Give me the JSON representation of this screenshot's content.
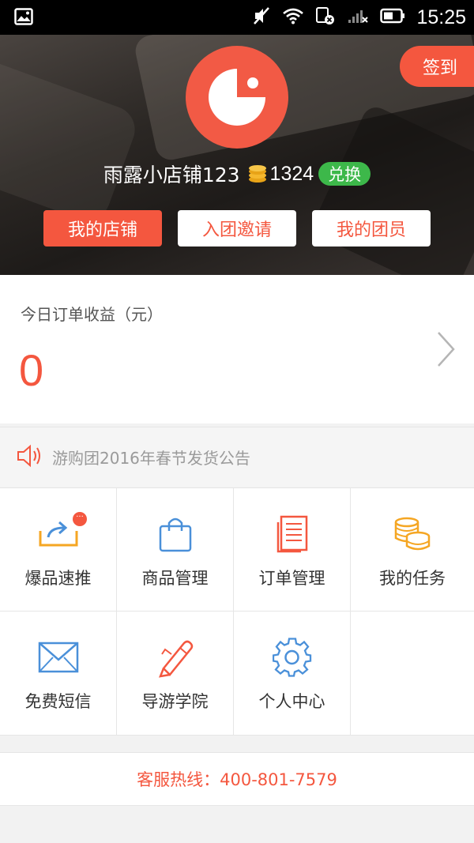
{
  "status_bar": {
    "time": "15:25",
    "icons": [
      "image-icon",
      "mute-icon",
      "wifi-icon",
      "sim-icon",
      "signal-icon",
      "battery-icon"
    ]
  },
  "header": {
    "sign_in_label": "签到",
    "shop_name": "雨露小店铺123",
    "points": "1324",
    "exchange_label": "兑换",
    "buttons": [
      "我的店铺",
      "入团邀请",
      "我的团员"
    ]
  },
  "earnings": {
    "label": "今日订单收益（元）",
    "value": "0"
  },
  "notice": {
    "text": "游购团2016年春节发货公告"
  },
  "grid": {
    "items": [
      {
        "label": "爆品速推",
        "icon": "share-icon"
      },
      {
        "label": "商品管理",
        "icon": "shopping-bag-icon"
      },
      {
        "label": "订单管理",
        "icon": "document-icon"
      },
      {
        "label": "我的任务",
        "icon": "coins-icon"
      },
      {
        "label": "免费短信",
        "icon": "envelope-icon"
      },
      {
        "label": "导游学院",
        "icon": "pencil-icon"
      },
      {
        "label": "个人中心",
        "icon": "gear-icon"
      }
    ],
    "badge_text": "···"
  },
  "hotline": {
    "text": "客服热线：400-801-7579"
  },
  "colors": {
    "accent": "#f4573f",
    "green": "#3db84a",
    "orange": "#f5a623",
    "blue": "#4a90d9"
  }
}
